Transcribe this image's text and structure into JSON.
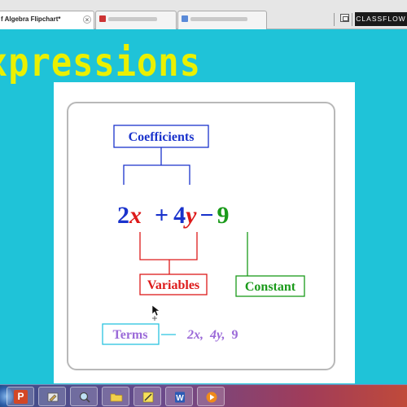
{
  "browser": {
    "tabs": [
      {
        "label": "f Algebra Flipchart*",
        "active": true
      },
      {
        "label": "",
        "active": false
      },
      {
        "label": "",
        "active": false
      }
    ],
    "brand": "CLASSFLOW"
  },
  "slide": {
    "title": "xpressions",
    "diagram": {
      "coefficients_label": "Coefficients",
      "expression": {
        "coef1": "2",
        "var1": "x",
        "plus": "+",
        "coef2": "4",
        "var2": "y",
        "minus": "−",
        "constant": "9"
      },
      "variables_label": "Variables",
      "constant_label": "Constant",
      "terms_label": "Terms",
      "terms": [
        "2x,",
        "4y,",
        "9"
      ]
    }
  },
  "taskbar": {
    "icons": [
      "start-orb-icon",
      "powerpoint-icon",
      "paint-icon",
      "search-icon",
      "folder-icon",
      "notes-icon",
      "word-icon",
      "media-player-icon"
    ]
  },
  "colors": {
    "background": "#1fc3d8",
    "title": "#eaf000",
    "coefficient_blue": "#1a33cc",
    "variable_red": "#dd1a1a",
    "constant_green": "#1a9a1a",
    "terms_cyan": "#2ac4e0",
    "terms_text": "#9b6ad8"
  }
}
